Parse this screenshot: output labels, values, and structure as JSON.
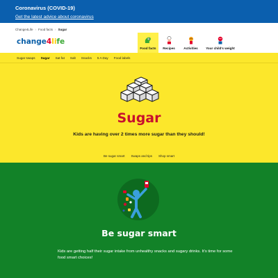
{
  "covid": {
    "title": "Coronavirus (COVID-19)",
    "link": "Get the latest advice about coronavirus"
  },
  "breadcrumb": {
    "items": [
      "Change4Life",
      "Food facts",
      "Sugar"
    ],
    "separator": "›"
  },
  "logo": {
    "part1": "change",
    "part2": "4",
    "part3": "li",
    "part4": "fe"
  },
  "nav": {
    "items": [
      {
        "label": "Food facts",
        "icon": "food-facts-icon",
        "active": true
      },
      {
        "label": "Recipes",
        "icon": "chef-icon"
      },
      {
        "label": "Activities",
        "icon": "activities-icon"
      },
      {
        "label": "Your child's weight",
        "icon": "weight-icon"
      }
    ]
  },
  "subnav": {
    "items": [
      "Sugar swaps",
      "Sugar",
      "Sat fat",
      "Salt",
      "Snacks",
      "5 A Day",
      "Food labels"
    ],
    "active": "Sugar"
  },
  "hero": {
    "title": "Sugar",
    "subtitle": "Kids are having over 2 times more sugar than they should!",
    "links": [
      "Be sugar smart",
      "Swaps and tips",
      "Shop smart"
    ]
  },
  "smart": {
    "title": "Be sugar smart",
    "body": "Kids are getting half their sugar intake from unhealthy snacks and sugary drinks. It's time for some food smart choices!"
  },
  "colors": {
    "covid_blue": "#0b5fae",
    "brand_yellow": "#fce72b",
    "sugar_red": "#c8102e",
    "smart_green": "#128228"
  }
}
